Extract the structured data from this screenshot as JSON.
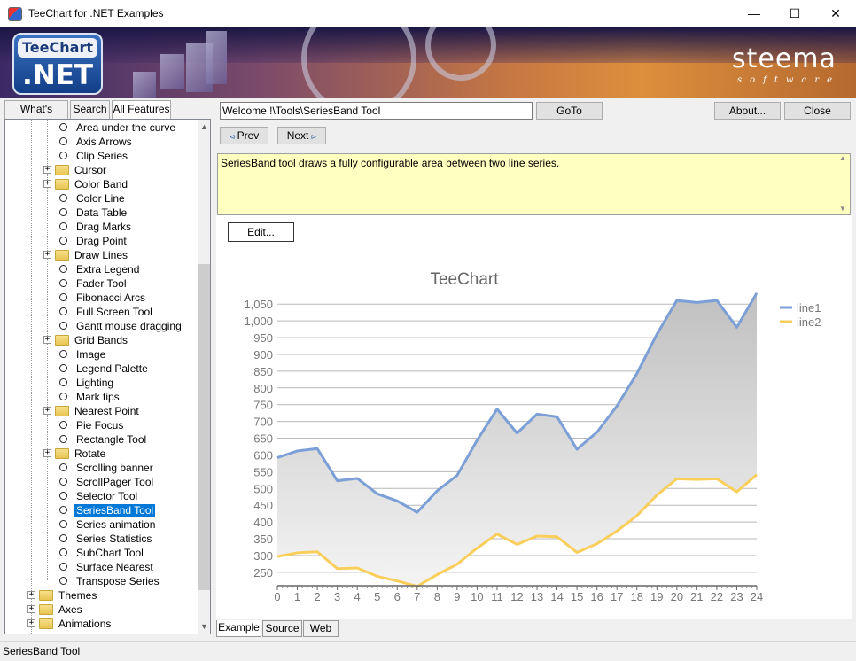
{
  "window": {
    "title": "TeeChart for .NET Examples",
    "minimize": "—",
    "maximize": "☐",
    "close": "✕"
  },
  "banner": {
    "logo_top": "TeeChart",
    "logo_bottom": ".NET",
    "brand": "steema",
    "brand_sub": "software"
  },
  "left_tabs": [
    "What's New?",
    "Search",
    "All Features"
  ],
  "tree": {
    "children": [
      {
        "label": "Area under the curve",
        "type": "item"
      },
      {
        "label": "Axis Arrows",
        "type": "item"
      },
      {
        "label": "Clip Series",
        "type": "item"
      },
      {
        "label": "Cursor",
        "type": "folder"
      },
      {
        "label": "Color Band",
        "type": "folder"
      },
      {
        "label": "Color Line",
        "type": "item"
      },
      {
        "label": "Data Table",
        "type": "item"
      },
      {
        "label": "Drag Marks",
        "type": "item"
      },
      {
        "label": "Drag Point",
        "type": "item"
      },
      {
        "label": "Draw Lines",
        "type": "folder"
      },
      {
        "label": "Extra Legend",
        "type": "item"
      },
      {
        "label": "Fader Tool",
        "type": "item"
      },
      {
        "label": "Fibonacci Arcs",
        "type": "item"
      },
      {
        "label": "Full Screen Tool",
        "type": "item"
      },
      {
        "label": "Gantt mouse dragging",
        "type": "item"
      },
      {
        "label": "Grid Bands",
        "type": "folder"
      },
      {
        "label": "Image",
        "type": "item"
      },
      {
        "label": "Legend Palette",
        "type": "item"
      },
      {
        "label": "Lighting",
        "type": "item"
      },
      {
        "label": "Mark tips",
        "type": "item"
      },
      {
        "label": "Nearest Point",
        "type": "folder"
      },
      {
        "label": "Pie Focus",
        "type": "item"
      },
      {
        "label": "Rectangle Tool",
        "type": "item"
      },
      {
        "label": "Rotate",
        "type": "folder"
      },
      {
        "label": "Scrolling banner",
        "type": "item"
      },
      {
        "label": "ScrollPager Tool",
        "type": "item"
      },
      {
        "label": "Selector Tool",
        "type": "item"
      },
      {
        "label": "SeriesBand Tool",
        "type": "item",
        "selected": true
      },
      {
        "label": "Series animation",
        "type": "item"
      },
      {
        "label": "Series Statistics",
        "type": "item"
      },
      {
        "label": "SubChart Tool",
        "type": "item"
      },
      {
        "label": "Surface Nearest",
        "type": "item"
      },
      {
        "label": "Transpose Series",
        "type": "item"
      }
    ],
    "top_level": [
      "Themes",
      "Axes",
      "Animations"
    ]
  },
  "nav": {
    "path": "Welcome !\\Tools\\SeriesBand Tool",
    "goto_label": "GoTo",
    "about_label": "About...",
    "close_label": "Close",
    "prev_label": "Prev",
    "next_label": "Next"
  },
  "description": "SeriesBand tool draws a fully configurable area between two line series.",
  "edit_label": "Edit...",
  "chart_data": {
    "type": "line",
    "title": "TeeChart",
    "x": [
      0,
      1,
      2,
      3,
      4,
      5,
      6,
      7,
      8,
      9,
      10,
      11,
      12,
      13,
      14,
      15,
      16,
      17,
      18,
      19,
      20,
      21,
      22,
      23,
      24
    ],
    "series": [
      {
        "name": "line1",
        "color": "#7b9fd6",
        "values": [
          592,
          612,
          619,
          523,
          530,
          484,
          463,
          429,
          493,
          539,
          644,
          737,
          665,
          722,
          714,
          617,
          668,
          746,
          843,
          960,
          1061,
          1055,
          1061,
          981,
          1083
        ]
      },
      {
        "name": "line2",
        "color": "#f9ce5b",
        "values": [
          297,
          308,
          311,
          261,
          263,
          238,
          224,
          208,
          243,
          274,
          322,
          364,
          333,
          358,
          356,
          309,
          335,
          373,
          419,
          480,
          529,
          527,
          529,
          490,
          541
        ]
      }
    ],
    "ylim": [
      210,
      1085
    ],
    "yticks": [
      250,
      300,
      350,
      400,
      450,
      500,
      550,
      600,
      650,
      700,
      750,
      800,
      850,
      900,
      950,
      1000,
      1050
    ],
    "ytick_labels": [
      "250",
      "300",
      "350",
      "400",
      "450",
      "500",
      "550",
      "600",
      "650",
      "700",
      "750",
      "800",
      "850",
      "900",
      "950",
      "1,000",
      "1,050"
    ],
    "xtick_labels": [
      "0",
      "1",
      "2",
      "3",
      "4",
      "5",
      "6",
      "7",
      "8",
      "9",
      "10",
      "11",
      "12",
      "13",
      "14",
      "15",
      "16",
      "17",
      "18",
      "19",
      "20",
      "21",
      "22",
      "23",
      "24"
    ],
    "band_fill": "#c8c8c8",
    "legend_position": "top-right",
    "grid": true
  },
  "bottom_tabs": [
    "Example",
    "Source",
    "Web"
  ],
  "status": "SeriesBand Tool"
}
